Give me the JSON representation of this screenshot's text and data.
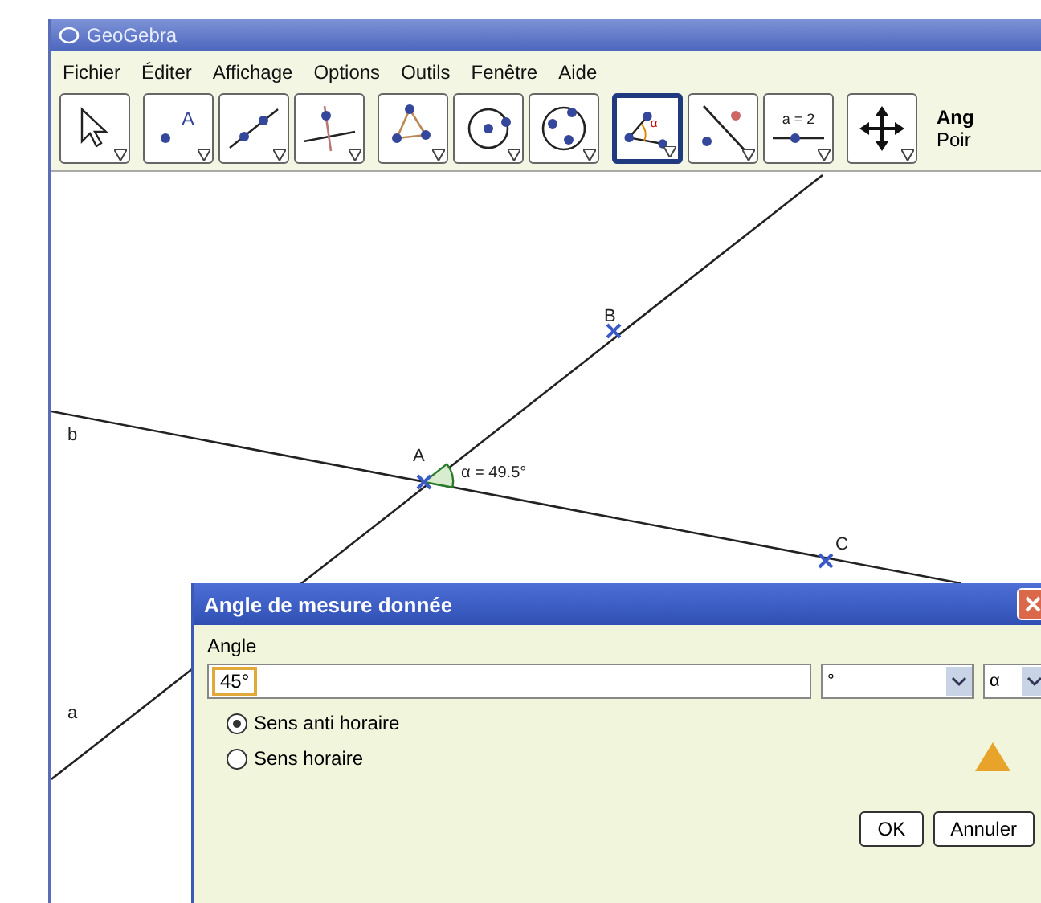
{
  "window": {
    "title": "GeoGebra"
  },
  "menu": [
    "Fichier",
    "Éditer",
    "Affichage",
    "Options",
    "Outils",
    "Fenêtre",
    "Aide"
  ],
  "toolbar": {
    "groups": [
      {
        "tools": [
          {
            "kind": "move",
            "selected": false
          }
        ]
      },
      {
        "tools": [
          {
            "kind": "point",
            "label": "A",
            "selected": false
          },
          {
            "kind": "line",
            "selected": false
          },
          {
            "kind": "perpendicular",
            "selected": false
          }
        ]
      },
      {
        "tools": [
          {
            "kind": "polygon",
            "selected": false
          },
          {
            "kind": "circle",
            "selected": false
          },
          {
            "kind": "conic",
            "selected": false
          }
        ]
      },
      {
        "tools": [
          {
            "kind": "angle",
            "label": "α",
            "selected": true
          },
          {
            "kind": "reflect",
            "selected": false
          },
          {
            "kind": "slider",
            "label": "a = 2",
            "selected": false
          }
        ]
      },
      {
        "tools": [
          {
            "kind": "move-view",
            "selected": false
          }
        ]
      }
    ],
    "tool_title": "Ang",
    "tool_hint": "Poir"
  },
  "canvas": {
    "lines": [
      {
        "name": "b"
      },
      {
        "name": "a"
      }
    ],
    "points": [
      {
        "name": "A"
      },
      {
        "name": "B"
      },
      {
        "name": "C"
      }
    ],
    "angle": {
      "label": "α = 49.5°"
    }
  },
  "dialog": {
    "title": "Angle de mesure donnée",
    "field_label": "Angle",
    "value": "45°",
    "unit_choice": "°",
    "symbol_choice": "α",
    "radios": [
      {
        "label": "Sens anti horaire",
        "selected": true
      },
      {
        "label": "Sens horaire",
        "selected": false
      }
    ],
    "buttons": [
      "OK",
      "Annuler"
    ]
  }
}
